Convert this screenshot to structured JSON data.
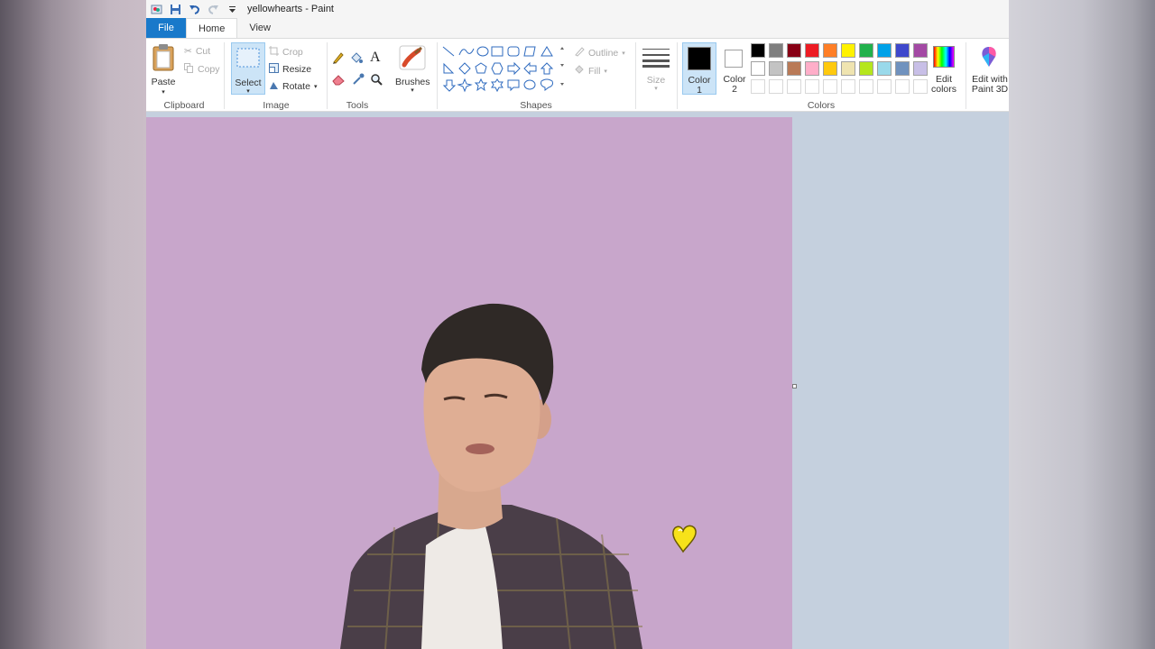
{
  "window": {
    "title": "yellowhearts - Paint"
  },
  "tabs": [
    "File",
    "Home",
    "View"
  ],
  "ribbon": {
    "clipboard": {
      "paste": "Paste",
      "cut": "Cut",
      "copy": "Copy",
      "label": "Clipboard"
    },
    "image": {
      "select": "Select",
      "crop": "Crop",
      "resize": "Resize",
      "rotate": "Rotate",
      "label": "Image"
    },
    "tools": {
      "label": "Tools"
    },
    "brushes": {
      "label": "Brushes"
    },
    "shapes": {
      "outline": "Outline",
      "fill": "Fill",
      "label": "Shapes"
    },
    "size": {
      "label": "Size"
    },
    "colors": {
      "color1_line1": "Color",
      "color1_line2": "1",
      "color2_line1": "Color",
      "color2_line2": "2",
      "edit_line1": "Edit",
      "edit_line2": "colors",
      "paint3d_line1": "Edit with",
      "paint3d_line2": "Paint 3D",
      "label": "Colors",
      "color1": "#000000",
      "color2": "#ffffff",
      "palette_row1": [
        "#000000",
        "#7f7f7f",
        "#880015",
        "#ed1c24",
        "#ff7f27",
        "#fff200",
        "#22b14c",
        "#00a2e8",
        "#3f48cc",
        "#a349a4"
      ],
      "palette_row2": [
        "#ffffff",
        "#c3c3c3",
        "#b97a57",
        "#ffaec9",
        "#ffc90e",
        "#efe4b0",
        "#b5e61d",
        "#99d9ea",
        "#7092be",
        "#c8bfe7"
      ]
    }
  },
  "canvas": {
    "background": "#c8a6cb"
  }
}
